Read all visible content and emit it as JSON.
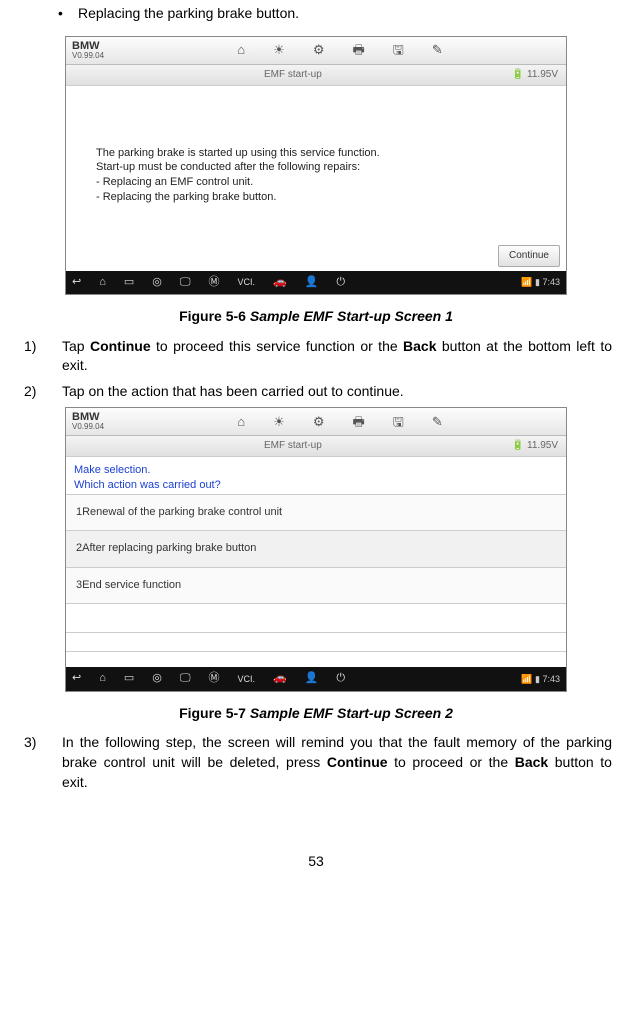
{
  "bullet": "Replacing the parking brake button.",
  "screenshot1": {
    "brand": "BMW",
    "ver": "V0.99.04",
    "subbar_title": "EMF start-up",
    "subbar_right": "11.95V",
    "body_lines": [
      "The parking brake is started up using this service function.",
      "Start-up must be conducted after the following repairs:",
      "- Replacing an EMF control unit.",
      "- Replacing the parking brake button."
    ],
    "continue_label": "Continue",
    "time": "7:43"
  },
  "caption1_prefix": "Figure 5-6",
  "caption1_rest": "Sample EMF Start-up Screen 1",
  "step1_num": "1)",
  "step1_a": "Tap ",
  "step1_bold1": "Continue",
  "step1_b": " to proceed this service function or the ",
  "step1_bold2": "Back",
  "step1_c": " button at the bottom left to exit.",
  "step2_num": "2)",
  "step2_text": "Tap on the action that has been carried out to continue.",
  "screenshot2": {
    "brand": "BMW",
    "ver": "V0.99.04",
    "subbar_title": "EMF start-up",
    "subbar_right": "11.95V",
    "prompt_line1": "Make selection.",
    "prompt_line2": "Which action was carried out?",
    "row1": "1Renewal of the parking brake control unit",
    "row2": "2After replacing parking brake button",
    "row3": "3End service function",
    "time": "7:43"
  },
  "caption2_prefix": "Figure 5-7",
  "caption2_rest": "Sample EMF Start-up Screen 2",
  "step3_num": "3)",
  "step3_a": "In the following step, the screen will remind you that the fault memory of the parking brake control unit will be deleted, press ",
  "step3_bold1": "Continue",
  "step3_b": " to proceed or the ",
  "step3_bold2": "Back",
  "step3_c": " button to exit.",
  "page_number": "53"
}
